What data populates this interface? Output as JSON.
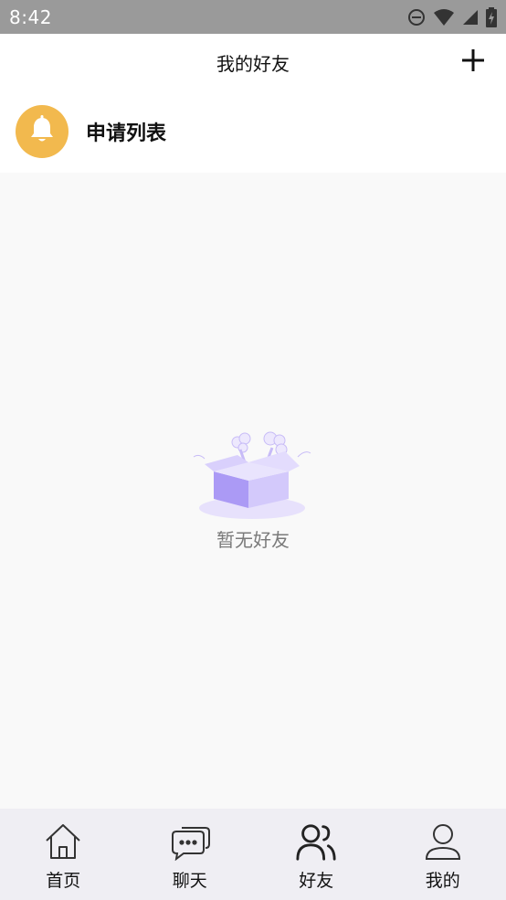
{
  "status_bar": {
    "time": "8:42"
  },
  "header": {
    "title": "我的好友",
    "add_icon": "plus-icon"
  },
  "apply_list": {
    "label": "申请列表",
    "icon": "bell-icon",
    "icon_bg": "#f2b94e"
  },
  "empty_state": {
    "text": "暂无好友",
    "illustration": "empty-box"
  },
  "bottom_nav": {
    "items": [
      {
        "label": "首页",
        "icon": "home-icon"
      },
      {
        "label": "聊天",
        "icon": "chat-icon"
      },
      {
        "label": "好友",
        "icon": "friends-icon",
        "active": true
      },
      {
        "label": "我的",
        "icon": "user-icon"
      }
    ]
  },
  "colors": {
    "status_bar": "#9a9a9a",
    "header_bg": "#ffffff",
    "content_bg": "#f9f9f9",
    "nav_bg": "#efeef3",
    "accent_purple": "#b3a3f7"
  }
}
